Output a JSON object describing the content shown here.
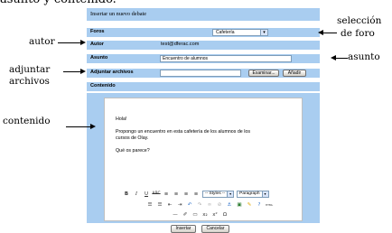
{
  "top_text": "asunto y contenido.",
  "form": {
    "header": "Insertar un nuevo debate",
    "foros_label": "Foros",
    "foros_selected": "Cafetería",
    "autor_label": "Autor",
    "autor_value": "test@dferac.com",
    "asunto_label": "Asunto",
    "asunto_value": "Encuentro de alumnos",
    "adjuntar_label": "Adjuntar archivos",
    "examinar_button": "Examinar...",
    "anadir_button": "Añadir",
    "contenido_label": "Contenido",
    "insertar_button": "Insertar",
    "cancelar_button": "Cancelar"
  },
  "editor": {
    "line1": "Hola!",
    "line2": "Propongo un encuentro en esta cafetería de los alumnos de los",
    "line3": "cursos de Olay.",
    "line4": "Qué os parece?",
    "toolbar": {
      "bold": "B",
      "italic": "I",
      "underline": "U",
      "strike": "ABC",
      "styles_select": "-- Styles --",
      "format_select": "Paragraph",
      "html": "HTML",
      "omega": "Ω"
    }
  },
  "annotations": {
    "autor": "autor",
    "adjuntar1": "adjuntar",
    "adjuntar2": "archivos",
    "contenido": "contenido",
    "seleccion1": "selección",
    "seleccion2": "de foro",
    "asunto": "asunto"
  }
}
